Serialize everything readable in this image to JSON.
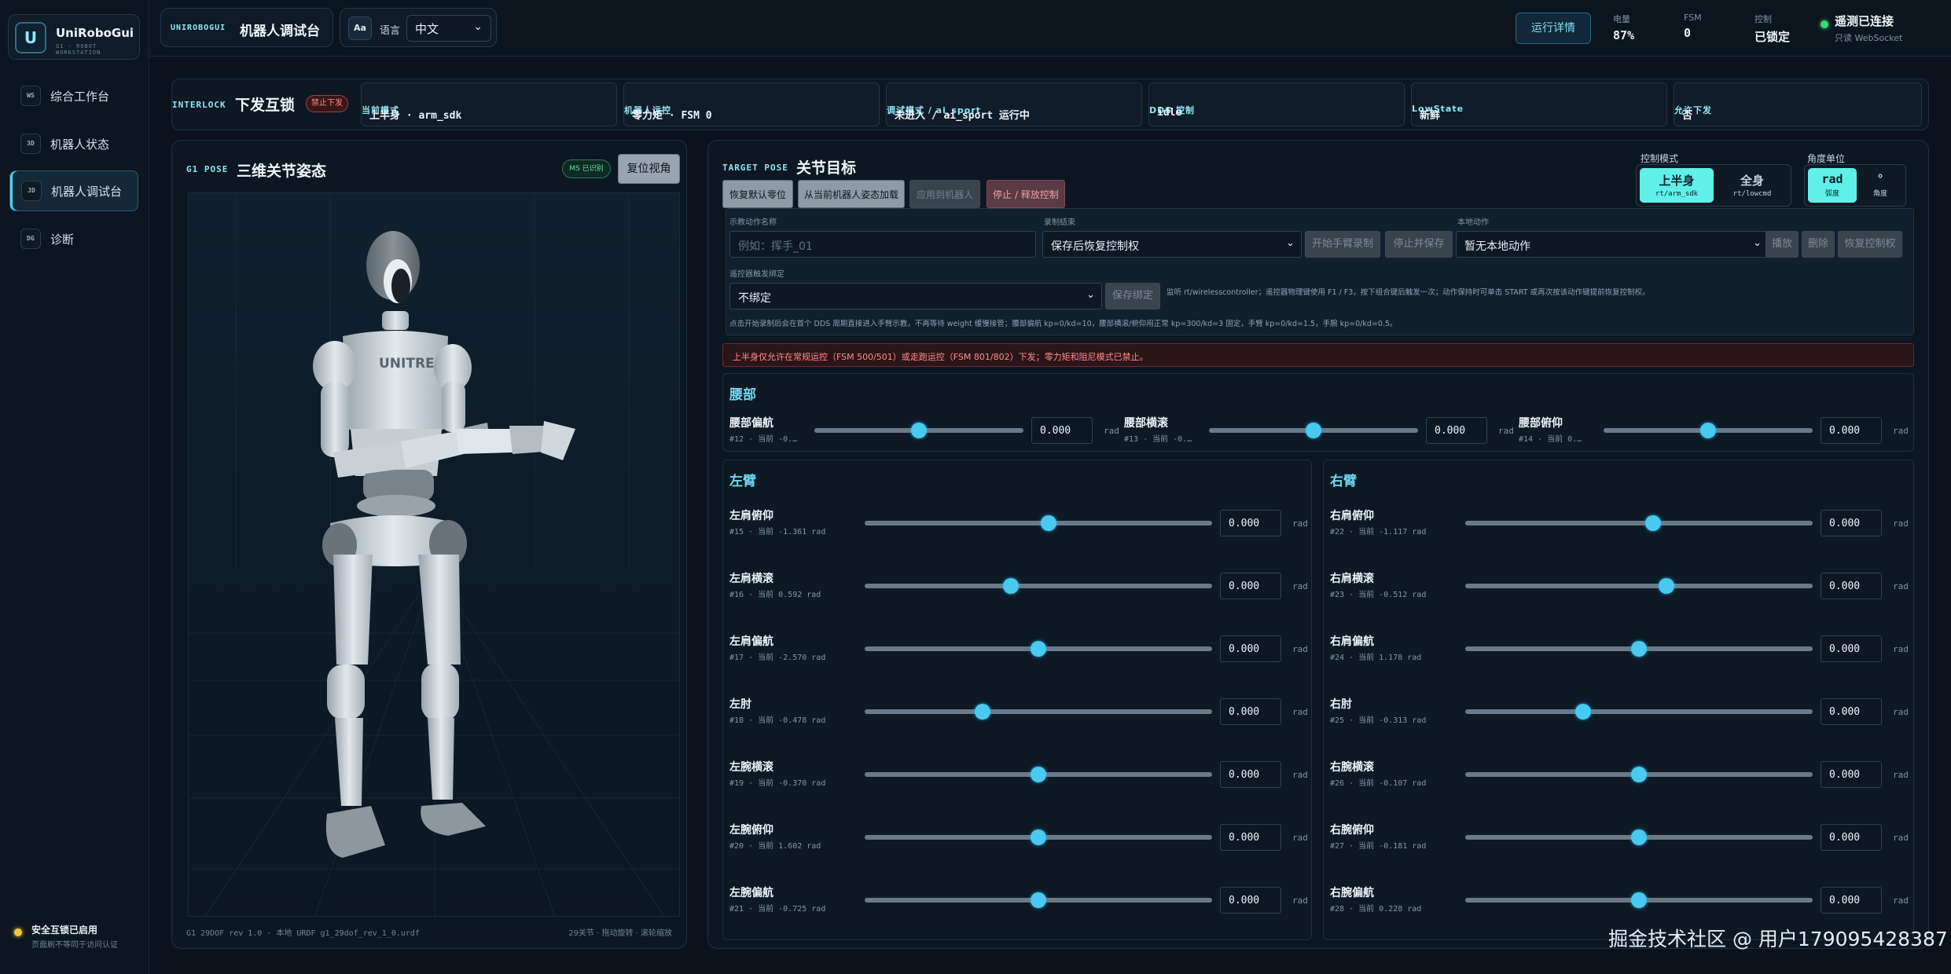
{
  "brand": {
    "logo_letter": "U",
    "name": "UniRoboGui",
    "subtitle": "G1 · ROBOT WORKSTATION"
  },
  "sidebar": {
    "items": [
      {
        "abbr": "WS",
        "label": "综合工作台",
        "active": false
      },
      {
        "abbr": "3D",
        "label": "机器人状态",
        "active": false
      },
      {
        "abbr": "JD",
        "label": "机器人调试台",
        "active": true
      },
      {
        "abbr": "DG",
        "label": "诊断",
        "active": false
      }
    ],
    "security": {
      "title": "安全互锁已启用",
      "subtitle": "页面刷不等同于访问认证"
    }
  },
  "topbar": {
    "crumb_key": "UNIROBOGUI",
    "crumb_title": "机器人调试台",
    "lang_icon": "Aa",
    "lang_label": "语言",
    "lang_value": "中文",
    "run_details": "运行详情",
    "stats": [
      {
        "key": "电量",
        "value": "87%"
      },
      {
        "key": "FSM",
        "value": "0"
      },
      {
        "key": "控制",
        "value": "已锁定"
      }
    ],
    "connection": {
      "title": "遥测已连接",
      "subtitle": "只读 WebSocket",
      "color": "#38d87a"
    }
  },
  "interlock": {
    "key": "INTERLOCK",
    "title": "下发互锁",
    "badge": "禁止下发",
    "cells": [
      {
        "key": "当前模式",
        "value": "上半身 · arm_sdk"
      },
      {
        "key": "机器人运控",
        "value": "零力矩 · FSM 0"
      },
      {
        "key": "调试模式 / ai_sport",
        "value": "未进入 / ai_sport 运行中"
      },
      {
        "key": "DDS 控制",
        "value": "idle"
      },
      {
        "key": "LowState",
        "value": "新鲜"
      },
      {
        "key": "允许下发",
        "value": "否"
      }
    ]
  },
  "pose": {
    "key": "G1 POSE",
    "title": "三维关节姿态",
    "ms_badge": "MS 已识别",
    "reset_btn": "复位视角",
    "footer_left": "G1 29DOF rev 1.0 · 本地 URDF g1_29dof_rev_1_0.urdf",
    "footer_right": "29关节 · 拖动旋转 · 滚轮缩放",
    "robot_brand": "UNITREE"
  },
  "target": {
    "key": "TARGET POSE",
    "title": "关节目标",
    "buttons": [
      "恢复默认零位",
      "从当前机器人姿态加载",
      "应用到机器人",
      "停止 / 释放控制"
    ],
    "control_mode": {
      "label": "控制模式",
      "options": [
        {
          "main": "上半身",
          "sub": "rt/arm_sdk",
          "on": true
        },
        {
          "main": "全身",
          "sub": "rt/lowcmd",
          "on": false
        }
      ]
    },
    "angle_unit": {
      "label": "角度单位",
      "options": [
        {
          "main": "rad",
          "sub": "弧度",
          "on": true
        },
        {
          "main": "°",
          "sub": "角度",
          "on": false
        }
      ]
    },
    "recording": {
      "name_label": "示教动作名称",
      "name_placeholder": "例如：挥手_01",
      "end_label": "录制结束",
      "end_value": "保存后恢复控制权",
      "start_btn": "开始手臂录制",
      "stop_btn": "停止并保存",
      "local_label": "本地动作",
      "local_value": "暂无本地动作",
      "play_btn": "播放",
      "delete_btn": "删除",
      "restore_btn": "恢复控制权",
      "bind_label": "遥控器触发绑定",
      "bind_value": "不绑定",
      "save_bind_btn": "保存绑定",
      "bind_note": "监听 rt/wirelesscontroller；遥控器物理键使用 F1 / F3，按下组合键后触发一次；动作保持时可单击 START 或再次按该动作键提前恢复控制权。",
      "hint": "点击开始录制后会在首个 DDS 周期直接进入手臂示教，不再等待 weight 缓慢接管；腰部偏航 kp=0/kd=10，腰部横滚/俯仰用正常 kp=300/kd=3 固定，手臂 kp=0/kd=1.5，手腕 kp=0/kd=0.5。"
    },
    "warning": "上半身仅允许在常规运控（FSM 500/501）或走跑运控（FSM 801/802）下发；零力矩和阻尼模式已禁止。",
    "unit": "rad",
    "waist": {
      "title": "腰部",
      "joints": [
        {
          "name": "腰部偏航",
          "desc": "#12 · 当前 -0.…",
          "value": "0.000",
          "pos": 0.5
        },
        {
          "name": "腰部横滚",
          "desc": "#13 · 当前 -0.…",
          "value": "0.000",
          "pos": 0.5
        },
        {
          "name": "腰部俯仰",
          "desc": "#14 · 当前 0.…",
          "value": "0.000",
          "pos": 0.5
        }
      ]
    },
    "left_arm": {
      "title": "左臂",
      "joints": [
        {
          "name": "左肩俯仰",
          "desc": "#15 · 当前 -1.361 rad",
          "value": "0.000",
          "pos": 0.53
        },
        {
          "name": "左肩横滚",
          "desc": "#16 · 当前 0.592 rad",
          "value": "0.000",
          "pos": 0.42
        },
        {
          "name": "左肩偏航",
          "desc": "#17 · 当前 -2.570 rad",
          "value": "0.000",
          "pos": 0.5
        },
        {
          "name": "左肘",
          "desc": "#18 · 当前 -0.478 rad",
          "value": "0.000",
          "pos": 0.34
        },
        {
          "name": "左腕横滚",
          "desc": "#19 · 当前 -0.370 rad",
          "value": "0.000",
          "pos": 0.5
        },
        {
          "name": "左腕俯仰",
          "desc": "#20 · 当前 1.602 rad",
          "value": "0.000",
          "pos": 0.5
        },
        {
          "name": "左腕偏航",
          "desc": "#21 · 当前 -0.725 rad",
          "value": "0.000",
          "pos": 0.5
        }
      ]
    },
    "right_arm": {
      "title": "右臂",
      "joints": [
        {
          "name": "右肩俯仰",
          "desc": "#22 · 当前 -1.117 rad",
          "value": "0.000",
          "pos": 0.54
        },
        {
          "name": "右肩横滚",
          "desc": "#23 · 当前 -0.512 rad",
          "value": "0.000",
          "pos": 0.58
        },
        {
          "name": "右肩偏航",
          "desc": "#24 · 当前 1.178 rad",
          "value": "0.000",
          "pos": 0.5
        },
        {
          "name": "右肘",
          "desc": "#25 · 当前 -0.313 rad",
          "value": "0.000",
          "pos": 0.34
        },
        {
          "name": "右腕横滚",
          "desc": "#26 · 当前 -0.107 rad",
          "value": "0.000",
          "pos": 0.5
        },
        {
          "name": "右腕俯仰",
          "desc": "#27 · 当前 -0.181 rad",
          "value": "0.000",
          "pos": 0.5
        },
        {
          "name": "右腕偏航",
          "desc": "#28 · 当前 0.228 rad",
          "value": "0.000",
          "pos": 0.5
        }
      ]
    }
  },
  "watermark": "掘金技术社区 @ 用户179095428387",
  "colors": {
    "accent": "#4ad6f0",
    "knob": "#49c9f0",
    "danger": "#ff8c86",
    "ok": "#38d87a",
    "warn": "#f4c53d"
  }
}
